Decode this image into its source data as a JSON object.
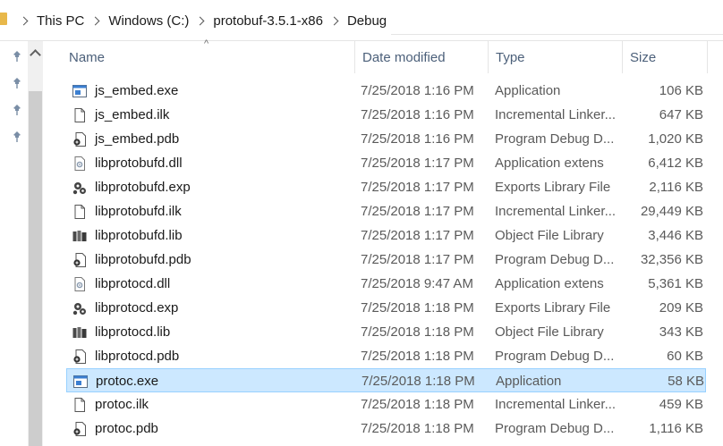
{
  "breadcrumb": [
    "This PC",
    "Windows (C:)",
    "protobuf-3.5.1-x86",
    "Debug"
  ],
  "columns": {
    "name": "Name",
    "date": "Date modified",
    "type": "Type",
    "size": "Size"
  },
  "sort_indicator": "^",
  "files": [
    {
      "name": "js_embed.exe",
      "date": "7/25/2018 1:16 PM",
      "type": "Application",
      "size": "106 KB",
      "icon": "exe-icon"
    },
    {
      "name": "js_embed.ilk",
      "date": "7/25/2018 1:16 PM",
      "type": "Incremental Linker...",
      "size": "647 KB",
      "icon": "ilk-icon"
    },
    {
      "name": "js_embed.pdb",
      "date": "7/25/2018 1:16 PM",
      "type": "Program Debug D...",
      "size": "1,020 KB",
      "icon": "pdb-icon"
    },
    {
      "name": "libprotobufd.dll",
      "date": "7/25/2018 1:17 PM",
      "type": "Application extens",
      "size": "6,412 KB",
      "icon": "dll-icon"
    },
    {
      "name": "libprotobufd.exp",
      "date": "7/25/2018 1:17 PM",
      "type": "Exports Library File",
      "size": "2,116 KB",
      "icon": "exp-icon"
    },
    {
      "name": "libprotobufd.ilk",
      "date": "7/25/2018 1:17 PM",
      "type": "Incremental Linker...",
      "size": "29,449 KB",
      "icon": "ilk-icon"
    },
    {
      "name": "libprotobufd.lib",
      "date": "7/25/2018 1:17 PM",
      "type": "Object File Library",
      "size": "3,446 KB",
      "icon": "lib-icon"
    },
    {
      "name": "libprotobufd.pdb",
      "date": "7/25/2018 1:17 PM",
      "type": "Program Debug D...",
      "size": "32,356 KB",
      "icon": "pdb-icon"
    },
    {
      "name": "libprotocd.dll",
      "date": "7/25/2018 9:47 AM",
      "type": "Application extens",
      "size": "5,361 KB",
      "icon": "dll-icon"
    },
    {
      "name": "libprotocd.exp",
      "date": "7/25/2018 1:18 PM",
      "type": "Exports Library File",
      "size": "209 KB",
      "icon": "exp-icon"
    },
    {
      "name": "libprotocd.lib",
      "date": "7/25/2018 1:18 PM",
      "type": "Object File Library",
      "size": "343 KB",
      "icon": "lib-icon"
    },
    {
      "name": "libprotocd.pdb",
      "date": "7/25/2018 1:18 PM",
      "type": "Program Debug D...",
      "size": "60 KB",
      "icon": "pdb-icon"
    },
    {
      "name": "protoc.exe",
      "date": "7/25/2018 1:18 PM",
      "type": "Application",
      "size": "58 KB",
      "icon": "exe-icon",
      "selected": true
    },
    {
      "name": "protoc.ilk",
      "date": "7/25/2018 1:18 PM",
      "type": "Incremental Linker...",
      "size": "459 KB",
      "icon": "ilk-icon"
    },
    {
      "name": "protoc.pdb",
      "date": "7/25/2018 1:18 PM",
      "type": "Program Debug D...",
      "size": "1,116 KB",
      "icon": "pdb-icon"
    }
  ],
  "colors": {
    "selection_bg": "#cce8ff",
    "selection_border": "#99d1ff",
    "header_text": "#4c607a",
    "folder": "#e8b84a"
  }
}
